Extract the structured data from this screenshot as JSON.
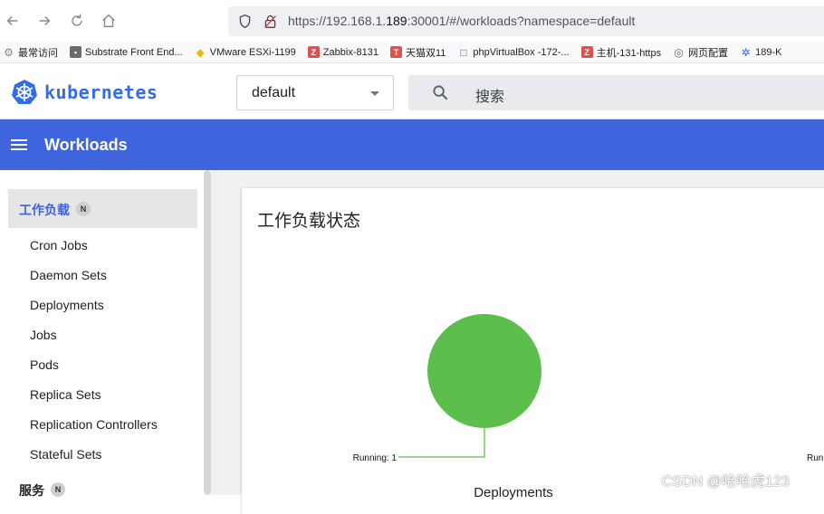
{
  "browser": {
    "url_prefix": "https://192.168.1.",
    "url_host": "189",
    "url_rest": ":30001/#/workloads?namespace=default",
    "bookmarks": [
      {
        "label": "最常访问",
        "icon": "gear-icon",
        "color": "#8a8a8a"
      },
      {
        "label": "Substrate Front End...",
        "icon": "page-icon",
        "color": "#6b6b6b"
      },
      {
        "label": "VMware ESXi-1199",
        "icon": "vmware-icon",
        "color": "#f2b705"
      },
      {
        "label": "Zabbix-8131",
        "icon": "zabbix-icon",
        "color": "#d9534f"
      },
      {
        "label": "天猫双11",
        "icon": "tmall-icon",
        "color": "#d9534f"
      },
      {
        "label": "phpVirtualBox -172-...",
        "icon": "vbox-icon",
        "color": "#3b6fb6"
      },
      {
        "label": "主机-131-https",
        "icon": "zabbix-icon",
        "color": "#d9534f"
      },
      {
        "label": "网页配置",
        "icon": "globe-icon",
        "color": "#6b6b6b"
      },
      {
        "label": "189-K",
        "icon": "k8s-icon",
        "color": "#326de6"
      }
    ]
  },
  "header": {
    "brand": "kubernetes",
    "namespace": "default",
    "search_placeholder": "搜索"
  },
  "toolbar": {
    "title": "Workloads"
  },
  "sidebar": {
    "section": "工作负载",
    "section_badge": "N",
    "items": [
      "Cron Jobs",
      "Daemon Sets",
      "Deployments",
      "Jobs",
      "Pods",
      "Replica Sets",
      "Replication Controllers",
      "Stateful Sets"
    ],
    "section2": "服务",
    "section2_badge": "N"
  },
  "main": {
    "card_title": "工作负载状态"
  },
  "chart_data": {
    "type": "pie",
    "title": "Deployments",
    "slices": [
      {
        "label": "Running",
        "value": 1,
        "color": "#5cbf4c"
      }
    ],
    "data_label": "Running: 1",
    "next_label": "Run"
  },
  "watermark": "CSDN @哈哈虎123"
}
